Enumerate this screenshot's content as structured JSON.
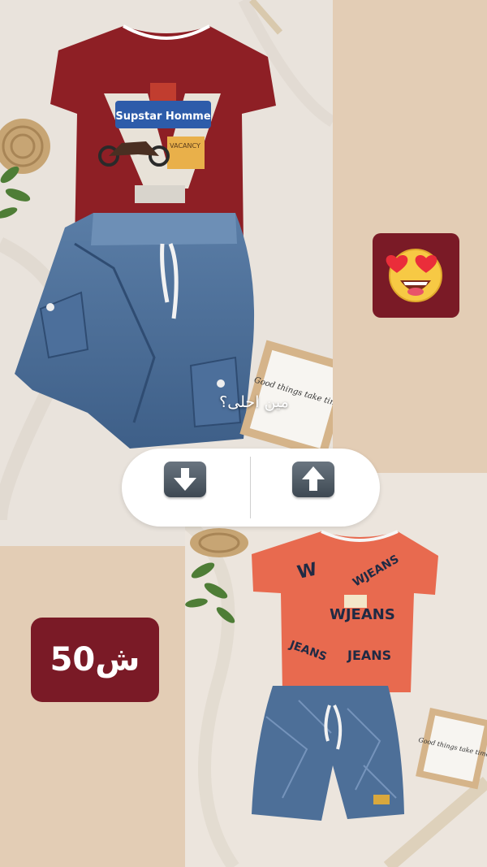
{
  "top_photo": {
    "tshirt_print_text": "Supstar Homme",
    "tshirt_small_text": "VACANCY",
    "frame_text": "Good things take time"
  },
  "bottom_photo": {
    "tshirt_print_text": "WJEANS",
    "frame_text": "Good things take time"
  },
  "poll": {
    "question": "مين احلى؟",
    "down_icon": "arrow-down-icon",
    "up_icon": "arrow-up-icon"
  },
  "emoji_sticker": {
    "icon": "heart-eyes-emoji-icon"
  },
  "price_tag": {
    "label": "50ش"
  },
  "colors": {
    "background": "#e3cdb5",
    "sticker_bg": "#7a1a26",
    "red_tshirt": "#8e1f25",
    "orange_tshirt": "#e86a4f",
    "denim": "#4d6f98"
  }
}
